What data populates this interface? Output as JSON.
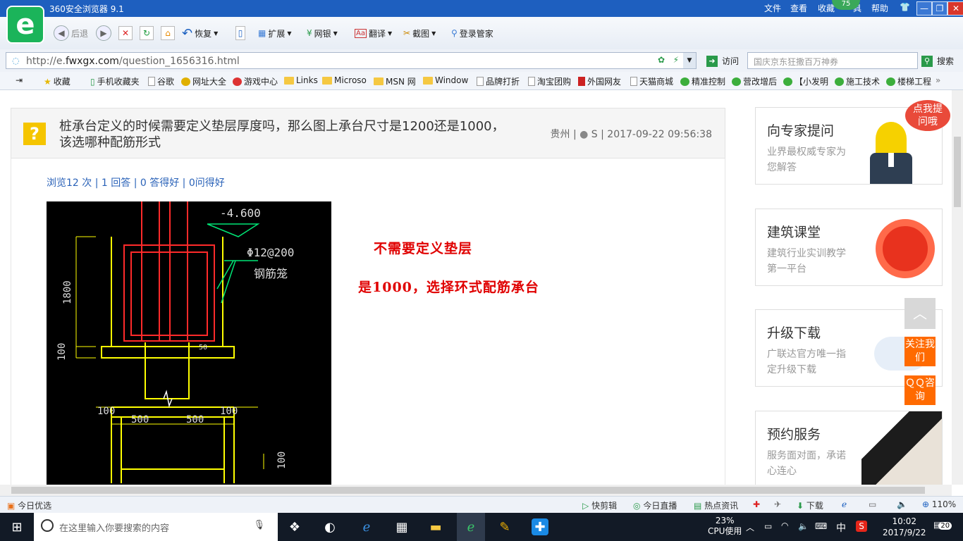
{
  "browser": {
    "title": "360安全浏览器 9.1",
    "menu": [
      "文件",
      "查看",
      "收藏",
      "帮助"
    ],
    "menu_partial": "具",
    "badge": "75",
    "toolbar": {
      "back": "后退",
      "restore": "恢复",
      "extend": "扩展",
      "bank": "网银",
      "translate": "翻译",
      "screenshot": "截图",
      "login": "登录管家"
    },
    "url_prefix": "http://e.",
    "url_domain": "fwxgx.com",
    "url_path": "/question_1656316.html",
    "visit": "访问",
    "search_placeholder": "国庆京东狂撒百万神券",
    "search_button": "搜索",
    "bookmarks": [
      "收藏",
      "手机收藏夹",
      "谷歌",
      "网址大全",
      "游戏中心",
      "Links",
      "Microso",
      "MSN 网",
      "Window",
      "品牌打折",
      "淘宝团购",
      "外国网友",
      "天猫商城",
      "精准控制",
      "营改增后",
      "【小发明",
      "施工技术",
      "楼梯工程"
    ],
    "more": "»"
  },
  "question": {
    "title": "桩承台定义的时候需要定义垫层厚度吗，那么图上承台尺寸是1200还是1000，该选哪种配筋形式",
    "location": "贵州",
    "user": "S",
    "time": "2017-09-22 09:56:38",
    "stats": "浏览12 次 | 1 回答 | 0 答得好 | 0问得好"
  },
  "drawing": {
    "elev": "-4.600",
    "rebar": "Φ12@200",
    "cage": "钢筋笼",
    "dim_1800": "1800",
    "dim_100a": "100",
    "dim_100b": "100",
    "dim_500a": "500",
    "dim_500b": "500",
    "dim_100c": "100",
    "dim_100d": "100",
    "dim_50": "50"
  },
  "answer": {
    "line1": "不需要定义垫层",
    "line2": "是1000，选择环式配筋承台"
  },
  "sidebar": {
    "cards": [
      {
        "title": "向专家提问",
        "desc": "业界最权威专家为您解答"
      },
      {
        "title": "建筑课堂",
        "desc": "建筑行业实训教学第一平台"
      },
      {
        "title": "升级下载",
        "desc": "广联达官方唯一指定升级下载"
      },
      {
        "title": "预约服务",
        "desc": "服务面对面，承诺心连心"
      }
    ],
    "bubble": "点我提问哦"
  },
  "float": {
    "follow": "关注我们",
    "qq": "ＱＱ咨询"
  },
  "status": {
    "today": "今日优选",
    "clip": "快剪辑",
    "live": "今日直播",
    "news": "热点资讯",
    "download": "下载",
    "zoom": "110%"
  },
  "taskbar": {
    "search_placeholder": "在这里输入你要搜索的内容",
    "cpu_pct": "23%",
    "cpu_label": "CPU使用",
    "ime": "中",
    "time": "10:02",
    "date": "2017/9/22",
    "notif": "20"
  }
}
